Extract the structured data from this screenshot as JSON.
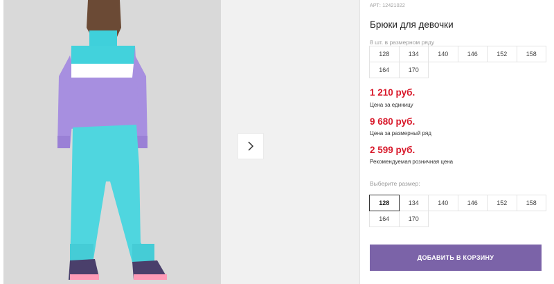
{
  "product": {
    "sku": "АРТ: 12421022",
    "title": "Брюки для девочки"
  },
  "size_row": {
    "label": "8 шт. в размерном ряду",
    "sizes": [
      "128",
      "134",
      "140",
      "146",
      "152",
      "158",
      "164",
      "170"
    ]
  },
  "prices": [
    {
      "value": "1 210 руб.",
      "caption": "Цена за единицу"
    },
    {
      "value": "9 680 руб.",
      "caption": "Цена за размерный ряд"
    },
    {
      "value": "2 599 руб.",
      "caption": "Рекомендуемая розничная цена"
    }
  ],
  "size_select": {
    "label": "Выберите размер:",
    "sizes": [
      "128",
      "134",
      "140",
      "146",
      "152",
      "158",
      "164",
      "170"
    ],
    "selected": "128"
  },
  "cart_button": "ДОБАВИТЬ В КОРЗИНУ",
  "colors": {
    "price": "#d8182a",
    "accent": "#7b63a8",
    "jacket": "#a78fe0",
    "pants": "#4fd6df"
  },
  "icons": {
    "next": "chevron-right-icon"
  }
}
